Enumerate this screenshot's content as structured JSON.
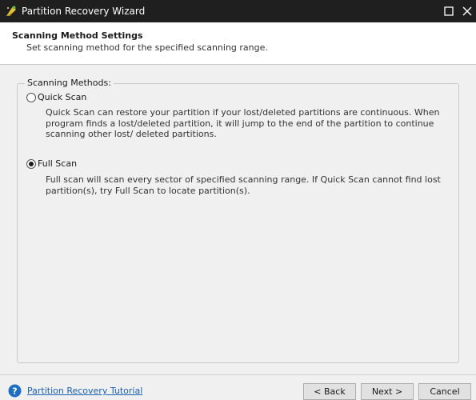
{
  "window": {
    "title": "Partition Recovery Wizard",
    "app_icon": "wizard-app-icon",
    "controls": [
      "maximize-icon",
      "close-icon"
    ]
  },
  "header": {
    "title": "Scanning Method Settings",
    "subtitle": "Set scanning method for the specified scanning range."
  },
  "scan_methods": {
    "group_label": "Scanning Methods:",
    "selected": "full_scan",
    "options": [
      {
        "id": "quick_scan",
        "label": "Quick Scan",
        "selected": false,
        "description": "Quick Scan can restore your partition if your lost/deleted partitions are continuous. When program finds a lost/deleted partition, it will jump to the end of the partition to continue scanning other lost/ deleted partitions."
      },
      {
        "id": "full_scan",
        "label": "Full Scan",
        "selected": true,
        "description": "Full scan will scan every sector of specified scanning range. If Quick Scan cannot find lost partition(s), try Full Scan to locate partition(s)."
      }
    ]
  },
  "footer": {
    "help_icon": "help-icon",
    "tutorial_link": "Partition Recovery Tutorial",
    "buttons": {
      "back": "< Back",
      "next": "Next >",
      "cancel": "Cancel"
    }
  },
  "colors": {
    "titlebar_bg": "#1f1f1f",
    "header_bg": "#ffffff",
    "body_bg": "#f0f0f0",
    "link": "#1a5fb4",
    "help_icon": "#1e6fc4"
  }
}
